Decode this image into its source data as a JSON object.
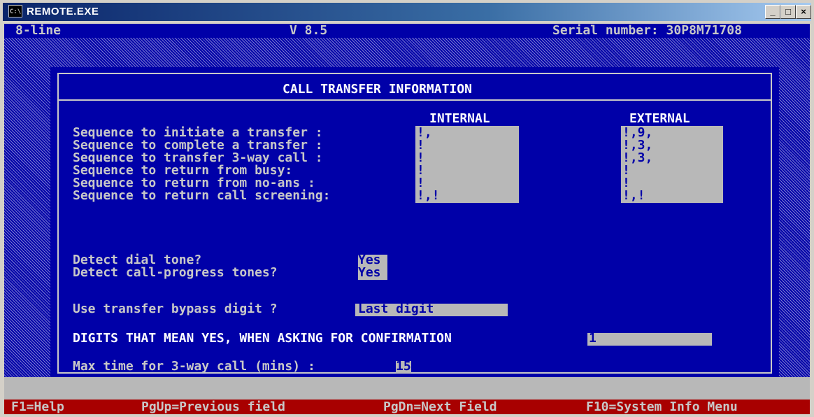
{
  "window": {
    "title": "REMOTE.EXE",
    "icon_text": "C:\\",
    "min": "_",
    "max": "□",
    "close": "×"
  },
  "header": {
    "mode": "8-line",
    "version": "V 8.5",
    "serial": "Serial number: 30P8M71708"
  },
  "dialog": {
    "title": "CALL TRANSFER INFORMATION",
    "col_internal": "INTERNAL",
    "col_external": "EXTERNAL",
    "rows": [
      {
        "label": "Sequence to initiate a transfer :",
        "internal": "!,",
        "external": "!,9,"
      },
      {
        "label": "Sequence to complete a transfer :",
        "internal": "!",
        "external": "!,3,"
      },
      {
        "label": "Sequence to transfer 3-way call :",
        "internal": "!",
        "external": "!,3,"
      },
      {
        "label": "Sequence to return from busy:",
        "internal": "!",
        "external": "!"
      },
      {
        "label": "Sequence to return from no-ans :",
        "internal": "!",
        "external": "!"
      },
      {
        "label": "Sequence to return call screening:",
        "internal": "!,!",
        "external": "!,!"
      }
    ],
    "detect_dial_label": "Detect dial tone?",
    "detect_dial_value": "Yes",
    "detect_cp_label": "Detect call-progress tones?",
    "detect_cp_value": "Yes",
    "bypass_label": "Use transfer bypass digit ?",
    "bypass_value": "Last digit",
    "confirm_label": "DIGITS THAT MEAN YES, WHEN ASKING FOR CONFIRMATION",
    "confirm_value": "1",
    "maxtime_label": "Max time for 3-way call (mins) :",
    "maxtime_value": "15"
  },
  "statusbar": {
    "help": "F1=Help",
    "prev": "PgUp=Previous field",
    "next": "PgDn=Next Field",
    "sysinfo": "F10=System Info Menu"
  }
}
